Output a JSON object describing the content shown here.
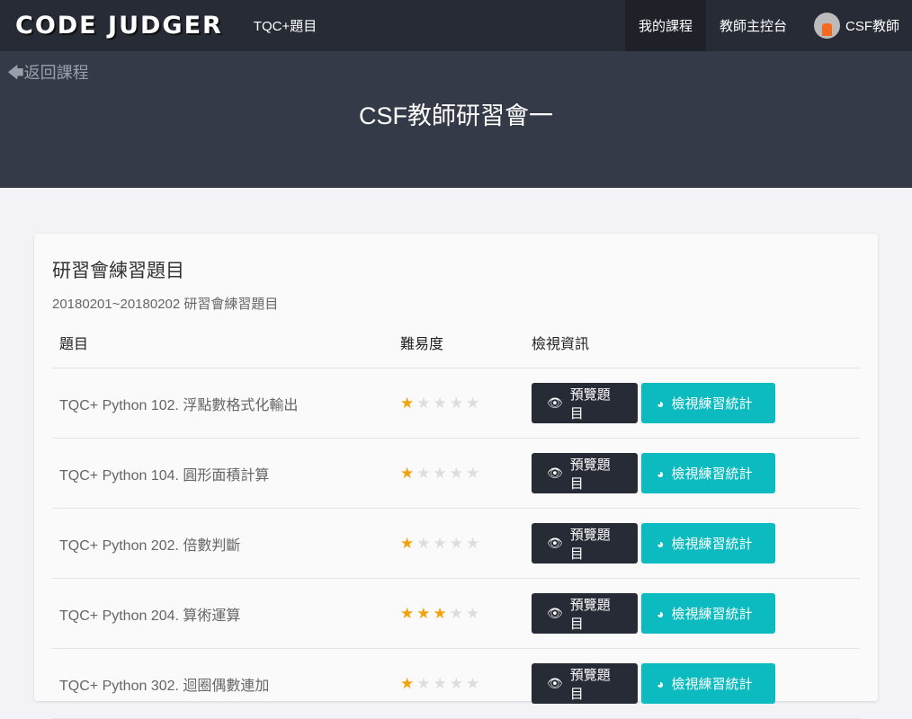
{
  "nav": {
    "logo": "CODE JUDGER",
    "link": "TQC+題目",
    "my_courses": "我的課程",
    "teacher_console": "教師主控台",
    "user": "CSF教師"
  },
  "hero": {
    "back": "返回課程",
    "title": "CSF教師研習會一"
  },
  "card": {
    "title": "研習會練習題目",
    "subtitle": "20180201~20180202 研習會練習題目",
    "headers": [
      "題目",
      "難易度",
      "檢視資訊"
    ],
    "preview_label": "預覽題目",
    "stats_label": "檢視練習統計",
    "rows": [
      {
        "name": "TQC+ Python 102. 浮點數格式化輸出",
        "difficulty": 1
      },
      {
        "name": "TQC+ Python 104. 圓形面積計算",
        "difficulty": 1
      },
      {
        "name": "TQC+ Python 202. 倍數判斷",
        "difficulty": 1
      },
      {
        "name": "TQC+ Python 204. 算術運算",
        "difficulty": 3
      },
      {
        "name": "TQC+ Python 302. 迴圈偶數連加",
        "difficulty": 1
      }
    ]
  },
  "colors": {
    "nav": "#262b36",
    "hero": "#343a48",
    "accent": "#0bbbbf",
    "star": "#f2a20b"
  }
}
